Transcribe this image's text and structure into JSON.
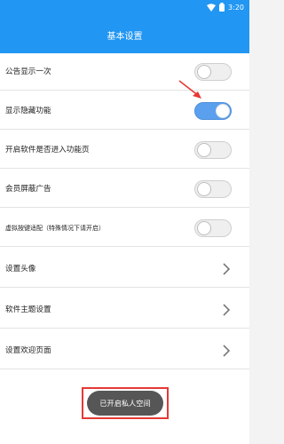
{
  "status": {
    "time": "3:20"
  },
  "header": {
    "title": "基本设置"
  },
  "settings": [
    {
      "label": "公告显示一次",
      "type": "toggle",
      "on": false
    },
    {
      "label": "显示隐藏功能",
      "type": "toggle",
      "on": true
    },
    {
      "label": "开启软件是否进入功能页",
      "type": "toggle",
      "on": false
    },
    {
      "label": "会员屏蔽广告",
      "type": "toggle",
      "on": false
    },
    {
      "label": "虚拟按键适配（特殊情况下请开启）",
      "type": "toggle",
      "on": false
    },
    {
      "label": "设置头像",
      "type": "link"
    },
    {
      "label": "软件主题设置",
      "type": "link"
    },
    {
      "label": "设置欢迎页面",
      "type": "link"
    }
  ],
  "private_space_button": "已开启私人空间",
  "colors": {
    "header": "#2196f3",
    "toggle_on": "#5aa0ee",
    "highlight": "#e53935",
    "button": "#565656"
  }
}
